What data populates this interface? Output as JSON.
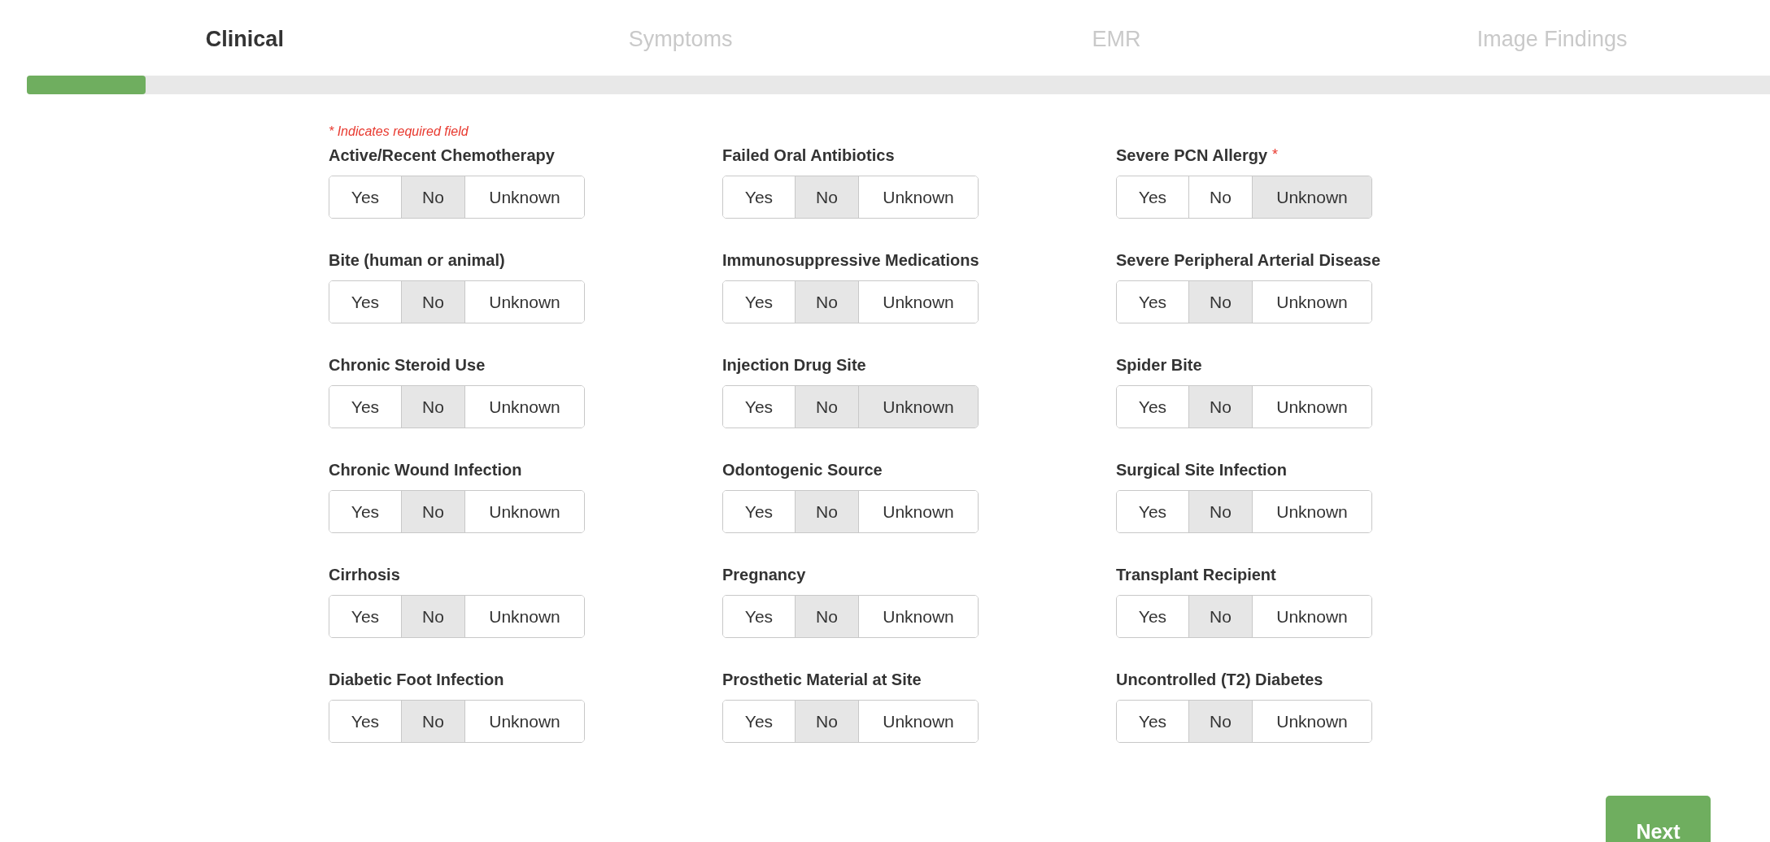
{
  "steps": [
    {
      "label": "Clinical",
      "selected": true
    },
    {
      "label": "Symptoms",
      "selected": false
    },
    {
      "label": "EMR",
      "selected": false
    },
    {
      "label": "Image Findings",
      "selected": false
    }
  ],
  "progress": {
    "level": 0.068
  },
  "required_note": "* Indicates required field",
  "columns": [
    {
      "fields": [
        {
          "label": "Active/Recent Chemotherapy",
          "options": [
            {
              "label": "Yes",
              "selected": false
            },
            {
              "label": "No",
              "selected": true
            },
            {
              "label": "Unknown",
              "selected": false
            }
          ]
        },
        {
          "label": "Bite (human or animal)",
          "options": [
            {
              "label": "Yes",
              "selected": false
            },
            {
              "label": "No",
              "selected": true
            },
            {
              "label": "Unknown",
              "selected": false
            }
          ]
        },
        {
          "label": "Chronic Steroid Use",
          "options": [
            {
              "label": "Yes",
              "selected": false
            },
            {
              "label": "No",
              "selected": true
            },
            {
              "label": "Unknown",
              "selected": false
            }
          ]
        },
        {
          "label": "Chronic Wound Infection",
          "options": [
            {
              "label": "Yes",
              "selected": false
            },
            {
              "label": "No",
              "selected": true
            },
            {
              "label": "Unknown",
              "selected": false
            }
          ]
        },
        {
          "label": "Cirrhosis",
          "options": [
            {
              "label": "Yes",
              "selected": false
            },
            {
              "label": "No",
              "selected": true
            },
            {
              "label": "Unknown",
              "selected": false
            }
          ]
        },
        {
          "label": "Diabetic Foot Infection",
          "options": [
            {
              "label": "Yes",
              "selected": false
            },
            {
              "label": "No",
              "selected": true
            },
            {
              "label": "Unknown",
              "selected": false
            }
          ]
        }
      ]
    },
    {
      "fields": [
        {
          "label": "Failed Oral Antibiotics",
          "options": [
            {
              "label": "Yes",
              "selected": false
            },
            {
              "label": "No",
              "selected": true
            },
            {
              "label": "Unknown",
              "selected": false
            }
          ]
        },
        {
          "label": "Immunosuppressive Medications",
          "options": [
            {
              "label": "Yes",
              "selected": false
            },
            {
              "label": "No",
              "selected": true
            },
            {
              "label": "Unknown",
              "selected": false
            }
          ]
        },
        {
          "label": "Injection Drug Site",
          "options": [
            {
              "label": "Yes",
              "selected": false
            },
            {
              "label": "No",
              "selected": true
            },
            {
              "label": "Unknown",
              "selected": true
            }
          ]
        },
        {
          "label": "Odontogenic Source",
          "options": [
            {
              "label": "Yes",
              "selected": false
            },
            {
              "label": "No",
              "selected": true
            },
            {
              "label": "Unknown",
              "selected": false
            }
          ]
        },
        {
          "label": "Pregnancy",
          "options": [
            {
              "label": "Yes",
              "selected": false
            },
            {
              "label": "No",
              "selected": true
            },
            {
              "label": "Unknown",
              "selected": false
            }
          ]
        },
        {
          "label": "Prosthetic Material at Site",
          "options": [
            {
              "label": "Yes",
              "selected": false
            },
            {
              "label": "No",
              "selected": true
            },
            {
              "label": "Unknown",
              "selected": false
            }
          ]
        }
      ]
    },
    {
      "fields": [
        {
          "label": "Severe PCN Allergy",
          "required_mark": "*",
          "options": [
            {
              "label": "Yes",
              "selected": false
            },
            {
              "label": "No",
              "selected": false
            },
            {
              "label": "Unknown",
              "selected": true
            }
          ]
        },
        {
          "label": "Severe Peripheral Arterial Disease",
          "options": [
            {
              "label": "Yes",
              "selected": false
            },
            {
              "label": "No",
              "selected": true
            },
            {
              "label": "Unknown",
              "selected": false
            }
          ]
        },
        {
          "label": "Spider Bite",
          "options": [
            {
              "label": "Yes",
              "selected": false
            },
            {
              "label": "No",
              "selected": true
            },
            {
              "label": "Unknown",
              "selected": false
            }
          ]
        },
        {
          "label": "Surgical Site Infection",
          "options": [
            {
              "label": "Yes",
              "selected": false
            },
            {
              "label": "No",
              "selected": true
            },
            {
              "label": "Unknown",
              "selected": false
            }
          ]
        },
        {
          "label": "Transplant Recipient",
          "options": [
            {
              "label": "Yes",
              "selected": false
            },
            {
              "label": "No",
              "selected": true
            },
            {
              "label": "Unknown",
              "selected": false
            }
          ]
        },
        {
          "label": "Uncontrolled (T2) Diabetes",
          "options": [
            {
              "label": "Yes",
              "selected": false
            },
            {
              "label": "No",
              "selected": true
            },
            {
              "label": "Unknown",
              "selected": false
            }
          ]
        }
      ]
    }
  ],
  "next_button": "Next"
}
